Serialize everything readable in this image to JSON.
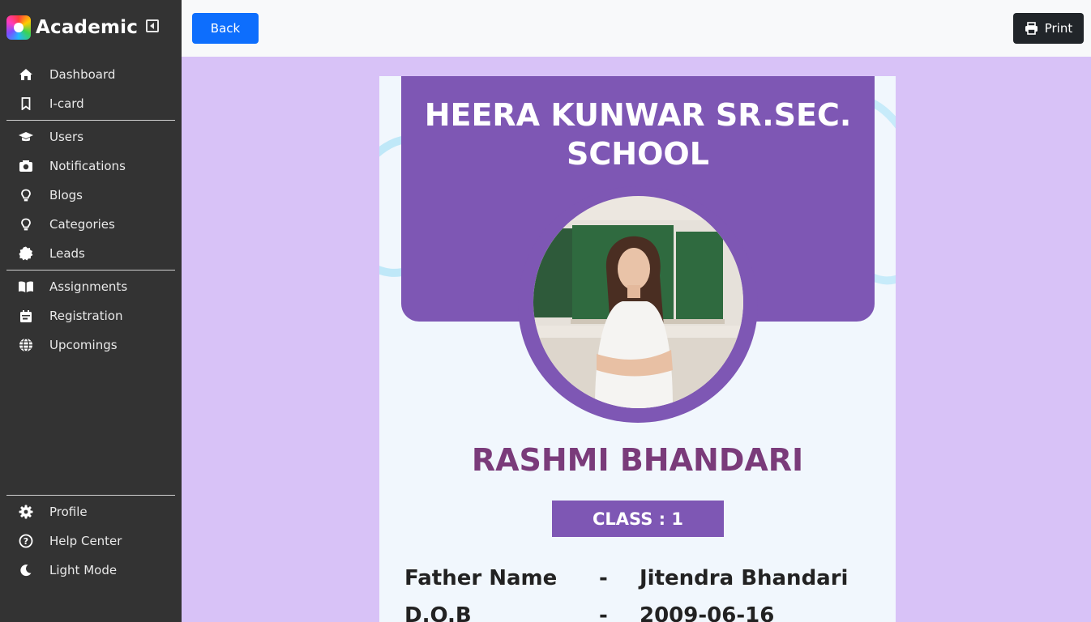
{
  "app": {
    "title": "Academic"
  },
  "sidebar": {
    "groups": [
      [
        {
          "label": "Dashboard",
          "icon": "home-icon"
        },
        {
          "label": "I-card",
          "icon": "bookmark-icon"
        }
      ],
      [
        {
          "label": "Users",
          "icon": "graduation-cap-icon"
        },
        {
          "label": "Notifications",
          "icon": "camera-icon"
        },
        {
          "label": "Blogs",
          "icon": "lightbulb-icon"
        },
        {
          "label": "Categories",
          "icon": "lightbulb-icon"
        },
        {
          "label": "Leads",
          "icon": "certificate-icon"
        }
      ],
      [
        {
          "label": "Assignments",
          "icon": "book-open-icon"
        },
        {
          "label": "Registration",
          "icon": "calendar-icon"
        },
        {
          "label": "Upcomings",
          "icon": "globe-icon"
        }
      ],
      [
        {
          "label": "Profile",
          "icon": "gear-icon"
        },
        {
          "label": "Help Center",
          "icon": "question-circle-icon"
        },
        {
          "label": "Light Mode",
          "icon": "moon-icon"
        }
      ]
    ]
  },
  "toolbar": {
    "back_label": "Back",
    "print_label": "Print"
  },
  "icard": {
    "school": "HEERA KUNWAR SR.SEC. SCHOOL",
    "student_name": "RASHMI BHANDARI",
    "class_label": "CLASS : 1",
    "details": [
      {
        "label": "Father Name",
        "sep": "-",
        "value": "Jitendra Bhandari"
      },
      {
        "label": "D.O.B",
        "sep": "-",
        "value": "2009-06-16"
      }
    ]
  },
  "colors": {
    "sidebar": "#333333",
    "primary": "#0d6efd",
    "card_purple": "#7e57b4",
    "name_color": "#7a3b7a",
    "page_bg": "#d8c2f7"
  }
}
